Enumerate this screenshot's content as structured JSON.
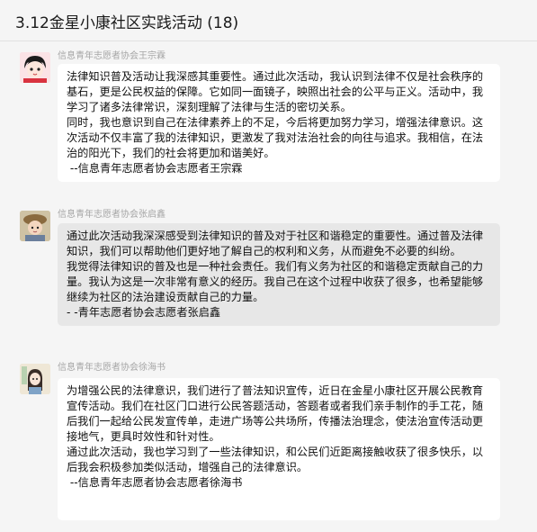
{
  "chat": {
    "title": "3.12金星小康社区实践活动 (18)"
  },
  "messages": [
    {
      "sender": "信息青年志愿者协会王宗霖",
      "paragraphs": [
        "法律知识普及活动让我深感其重要性。通过此次活动，我认识到法律不仅是社会秩序的基石，更是公民权益的保障。它如同一面镜子，映照出社会的公平与正义。活动中，我学习了诸多法律常识，深刻理解了法律与生活的密切关系。",
        "同时，我也意识到自己在法律素养上的不足，今后将更加努力学习，增强法律意识。这次活动不仅丰富了我的法律知识，更激发了我对法治社会的向往与追求。我相信，在法治的阳光下，我们的社会将更加和谐美好。",
        " --信息青年志愿者协会志愿者王宗霖"
      ]
    },
    {
      "sender": "信息青年志愿者协会张启鑫",
      "paragraphs": [
        "通过此次活动我深深感受到法律知识的普及对于社区和谐稳定的重要性。通过普及法律知识，我们可以帮助他们更好地了解自己的权利和义务，从而避免不必要的纠纷。",
        "我觉得法律知识的普及也是一种社会责任。我们有义务为社区的和谐稳定贡献自己的力量。我认为这是一次非常有意义的经历。我自己在这个过程中收获了很多，也希望能够继续为社区的法治建设贡献自己的力量。",
        "- -青年志愿者协会志愿者张启鑫"
      ]
    },
    {
      "sender": "信息青年志愿者协会徐海书",
      "paragraphs": [
        "为增强公民的法律意识，我们进行了普法知识宣传，近日在金星小康社区开展公民教育宣传活动。我们在社区门口进行公民答题活动，答题者或者我们亲手制作的手工花，随后我们一起给公民发宣传单，走进广场等公共场所，传播法治理念，使法治宣传活动更接地气，更具时效性和针对性。",
        "通过此次活动，我也学习到了一些法律知识，和公民们近距离接触收获了很多快乐，以后我会积极参加类似活动，增强自己的法律意识。",
        " --信息青年志愿者协会志愿者徐海书"
      ]
    }
  ]
}
